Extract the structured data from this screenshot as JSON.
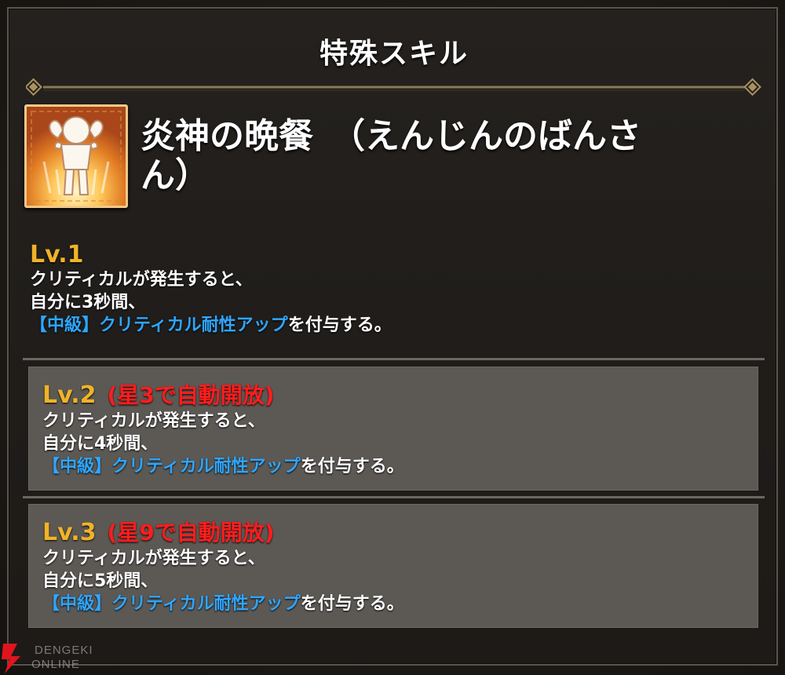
{
  "panel": {
    "title": "特殊スキル"
  },
  "skill": {
    "icon": "muscle-pose-icon",
    "name": "炎神の晩餐　（えんじんのばんさん）"
  },
  "levels": [
    {
      "label": "Lv.1",
      "unlock": "",
      "lines": [
        "クリティカルが発生すると、",
        "自分に3秒間、"
      ],
      "effect_highlight": "【中級】クリティカル耐性アップ",
      "effect_suffix": "を付与する。"
    },
    {
      "label": "Lv.2",
      "unlock": "(星3で自動開放)",
      "lines": [
        "クリティカルが発生すると、",
        "自分に4秒間、"
      ],
      "effect_highlight": "【中級】クリティカル耐性アップ",
      "effect_suffix": "を付与する。"
    },
    {
      "label": "Lv.3",
      "unlock": "(星9で自動開放)",
      "lines": [
        "クリティカルが発生すると、",
        "自分に5秒間、"
      ],
      "effect_highlight": "【中級】クリティカル耐性アップ",
      "effect_suffix": "を付与する。"
    }
  ],
  "colors": {
    "level_label": "#f0b328",
    "unlock_text": "#ff1d1d",
    "effect_highlight": "#2fa6ff",
    "locked_box": "#5c5955"
  },
  "watermark": {
    "line1": "DENGEKI",
    "line2": "ONLINE"
  }
}
